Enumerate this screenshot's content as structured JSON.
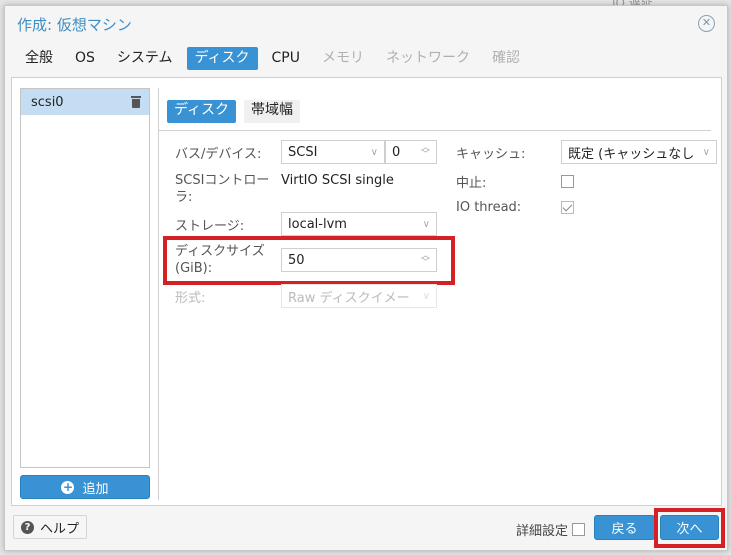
{
  "background": {
    "partial_text": "IO 遅延"
  },
  "dialog": {
    "title": "作成: 仮想マシン",
    "close_icon": "close-circle-icon"
  },
  "tabs": [
    {
      "label": "全般",
      "state": "normal"
    },
    {
      "label": "OS",
      "state": "normal"
    },
    {
      "label": "システム",
      "state": "normal"
    },
    {
      "label": "ディスク",
      "state": "active"
    },
    {
      "label": "CPU",
      "state": "normal"
    },
    {
      "label": "メモリ",
      "state": "disabled"
    },
    {
      "label": "ネットワーク",
      "state": "disabled"
    },
    {
      "label": "確認",
      "state": "disabled"
    }
  ],
  "disk_list": {
    "items": [
      {
        "label": "scsi0",
        "selected": true,
        "icon": "trash-icon"
      }
    ],
    "add_button": {
      "label": "追加",
      "icon": "plus-circle-icon"
    }
  },
  "subtabs": [
    {
      "label": "ディスク",
      "active": true
    },
    {
      "label": "帯域幅",
      "active": false
    }
  ],
  "form": {
    "bus_device": {
      "label": "バス/デバイス:",
      "bus_value": "SCSI",
      "device_value": "0"
    },
    "scsi_controller": {
      "label": "SCSIコントローラ:",
      "value": "VirtIO SCSI single"
    },
    "storage": {
      "label": "ストレージ:",
      "value": "local-lvm"
    },
    "disk_size": {
      "label": "ディスクサイズ (GiB):",
      "value": "50"
    },
    "format": {
      "label": "形式:",
      "value": "Raw ディスクイメー",
      "disabled": true
    },
    "cache": {
      "label": "キャッシュ:",
      "value": "既定 (キャッシュなし"
    },
    "discard": {
      "label": "中止:",
      "checked": false
    },
    "io_thread": {
      "label": "IO thread:",
      "checked": true,
      "disabled": true
    }
  },
  "footer": {
    "help_button": {
      "label": "ヘルプ",
      "icon": "question-circle-icon"
    },
    "advanced": {
      "label": "詳細設定",
      "checked": false
    },
    "back_button": "戻る",
    "next_button": "次へ"
  },
  "colors": {
    "accent": "#3892d3",
    "title": "#3e8ec6",
    "highlight": "#d42126",
    "selected_row": "#c4ddf2"
  }
}
